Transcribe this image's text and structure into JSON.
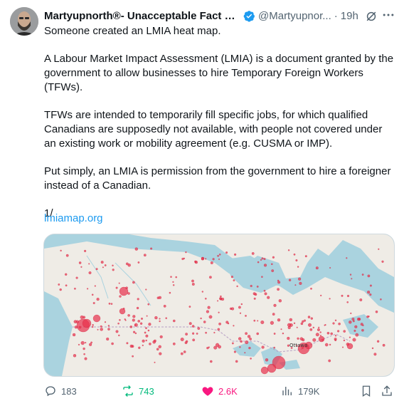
{
  "tweet": {
    "author_name": "Martyupnorth®- Unacceptable Fact Ch...",
    "handle": "@Martyupnor...",
    "separator": "·",
    "time": "19h",
    "paragraphs": [
      "Someone created an LMIA heat map.",
      "A Labour Market Impact Assessment (LMIA) is a document granted by the government to allow businesses to hire Temporary Foreign Workers (TFWs).",
      "TFWs are intended to temporarily fill specific jobs, for which qualified Canadians are supposedly not available, with people not covered under an existing work or mobility agreement (e.g. CUSMA or IMP).",
      "Put simply, an LMIA is permission from the government to hire a foreigner instead of a Canadian.",
      "1/"
    ],
    "link_text": "lmiamap.org",
    "map_label": "Ottawa"
  },
  "actions": {
    "replies": "183",
    "reposts": "743",
    "likes": "2.6K",
    "views": "179K"
  },
  "colors": {
    "link": "#1d9bf0",
    "repost": "#00ba7c",
    "like": "#f91880",
    "verified": "#1d9bf0",
    "heat_dot": "#e8314b"
  }
}
